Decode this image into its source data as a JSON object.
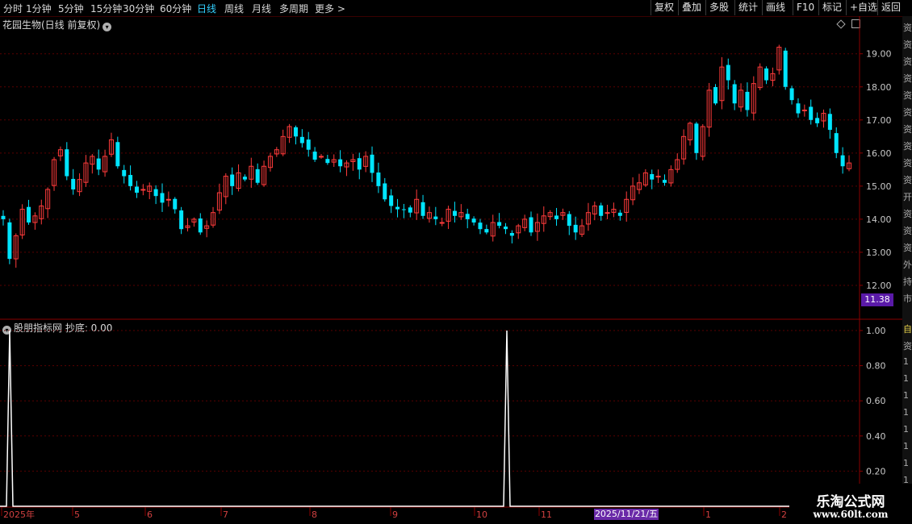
{
  "toolbar": {
    "periods": [
      {
        "label": "分时",
        "active": false
      },
      {
        "label": "1分钟",
        "active": false
      },
      {
        "label": "5分钟",
        "active": false
      },
      {
        "label": "15分钟",
        "active": false
      },
      {
        "label": "30分钟",
        "active": false
      },
      {
        "label": "60分钟",
        "active": false
      },
      {
        "label": "日线",
        "active": true
      },
      {
        "label": "周线",
        "active": false
      },
      {
        "label": "月线",
        "active": false
      },
      {
        "label": "多周期",
        "active": false
      },
      {
        "label": "更多 >",
        "active": false
      }
    ],
    "actions": [
      "复权",
      "叠加",
      "多股",
      "统计",
      "画线",
      "F10",
      "标记",
      "+自选",
      "返回"
    ]
  },
  "main_chart": {
    "title": "花园生物(日线 前复权)",
    "price_ticks": [
      "19.00",
      "18.00",
      "17.00",
      "16.00",
      "15.00",
      "14.00",
      "13.00",
      "12.00"
    ],
    "current_price_label": "11.38"
  },
  "indicator": {
    "title": "股朋指标网 抄底: 0.00",
    "ticks": [
      "1.00",
      "0.80",
      "0.60",
      "0.40",
      "0.20"
    ]
  },
  "date_axis": {
    "labels": [
      "2025年",
      "5",
      "6",
      "7",
      "8",
      "9",
      "10",
      "11",
      "1",
      "2"
    ],
    "cursor_label": "2025/11/21/五"
  },
  "right_strip": {
    "top_chars": [
      "资",
      "资",
      "资",
      "资",
      "资",
      "资",
      "资",
      "资",
      "资",
      "资",
      "开",
      "资",
      "资",
      "资",
      "外",
      "持",
      "市"
    ],
    "bottom_chars": [
      "自",
      "资",
      "1",
      "1",
      "1",
      "1",
      "1",
      "1",
      "1",
      "1"
    ]
  },
  "watermark": {
    "title": "乐淘公式网",
    "url": "www.60lt.com"
  },
  "colors": {
    "up": "#ff3b3b",
    "down": "#00e5ff",
    "axis": "#8a0000",
    "grid": "#5a0000",
    "active_tab": "#33d0ff"
  },
  "chart_data": {
    "type": "candlestick",
    "ylim": [
      11.0,
      19.7
    ],
    "x_labels": [
      "2025年",
      "5",
      "6",
      "7",
      "8",
      "9",
      "10",
      "11",
      "1",
      "2"
    ],
    "close_series": [
      14.0,
      12.8,
      13.5,
      14.3,
      13.9,
      14.1,
      14.4,
      14.9,
      15.8,
      16.1,
      15.3,
      14.9,
      15.2,
      15.7,
      15.9,
      15.5,
      15.9,
      16.4,
      15.6,
      15.3,
      15.0,
      14.8,
      14.9,
      15.0,
      14.7,
      14.5,
      14.6,
      14.3,
      13.7,
      13.8,
      14.0,
      13.6,
      13.8,
      14.2,
      14.8,
      15.3,
      15.0,
      15.4,
      15.2,
      15.6,
      15.1,
      15.6,
      15.9,
      16.1,
      16.5,
      16.8,
      16.5,
      16.3,
      16.1,
      15.8,
      15.9,
      15.7,
      15.8,
      15.6,
      15.7,
      15.8,
      15.5,
      15.9,
      15.4,
      15.0,
      14.6,
      14.4,
      14.3,
      14.3,
      14.2,
      14.6,
      14.1,
      14.2,
      14.0,
      13.9,
      14.3,
      14.1,
      14.2,
      14.0,
      13.9,
      13.7,
      13.6,
      13.9,
      13.8,
      13.7,
      13.5,
      13.8,
      14.0,
      13.6,
      13.9,
      14.1,
      14.2,
      14.0,
      14.2,
      13.8,
      13.6,
      13.8,
      14.2,
      14.4,
      14.1,
      14.2,
      14.3,
      14.1,
      14.6,
      15.0,
      15.1,
      15.4,
      15.2,
      15.3,
      15.1,
      15.5,
      15.8,
      16.5,
      16.9,
      16.0,
      16.8,
      17.9,
      17.5,
      18.6,
      18.2,
      17.5,
      17.9,
      17.3,
      18.1,
      18.6,
      18.2,
      18.4,
      19.2,
      18.0,
      17.6,
      17.2,
      17.3,
      17.0,
      16.9,
      17.2,
      16.7,
      16.0,
      15.6,
      15.7
    ],
    "indicator_series": [
      {
        "name": "抄底",
        "values": [
          1,
          0,
          0,
          0,
          0,
          0,
          0,
          0,
          0,
          0,
          0,
          0,
          0,
          0,
          0,
          0,
          0,
          0,
          0,
          0,
          0,
          0,
          0,
          0,
          0,
          0,
          0,
          0,
          0,
          0,
          0,
          0,
          0,
          0,
          0,
          0,
          0,
          0,
          0,
          0,
          0,
          0,
          0,
          0,
          0,
          0,
          0,
          0,
          0,
          0,
          0,
          0,
          0,
          0,
          0,
          0,
          0,
          0,
          0,
          0,
          0,
          0,
          0,
          0,
          0,
          0,
          0,
          0,
          0,
          0,
          0,
          0,
          0,
          0,
          0,
          0,
          0,
          0,
          0,
          1,
          0,
          0,
          0,
          0,
          0,
          0,
          0,
          0,
          0,
          0,
          0,
          0,
          0,
          0,
          0,
          0,
          0,
          0,
          0,
          0,
          0,
          0,
          0,
          0,
          0,
          0,
          0,
          0,
          0,
          0,
          0,
          0,
          0,
          0,
          0,
          0,
          0,
          0,
          0,
          0,
          0,
          0,
          0,
          0,
          0,
          0,
          0,
          0,
          0,
          0,
          0,
          0,
          0,
          0,
          0,
          0
        ]
      }
    ]
  }
}
